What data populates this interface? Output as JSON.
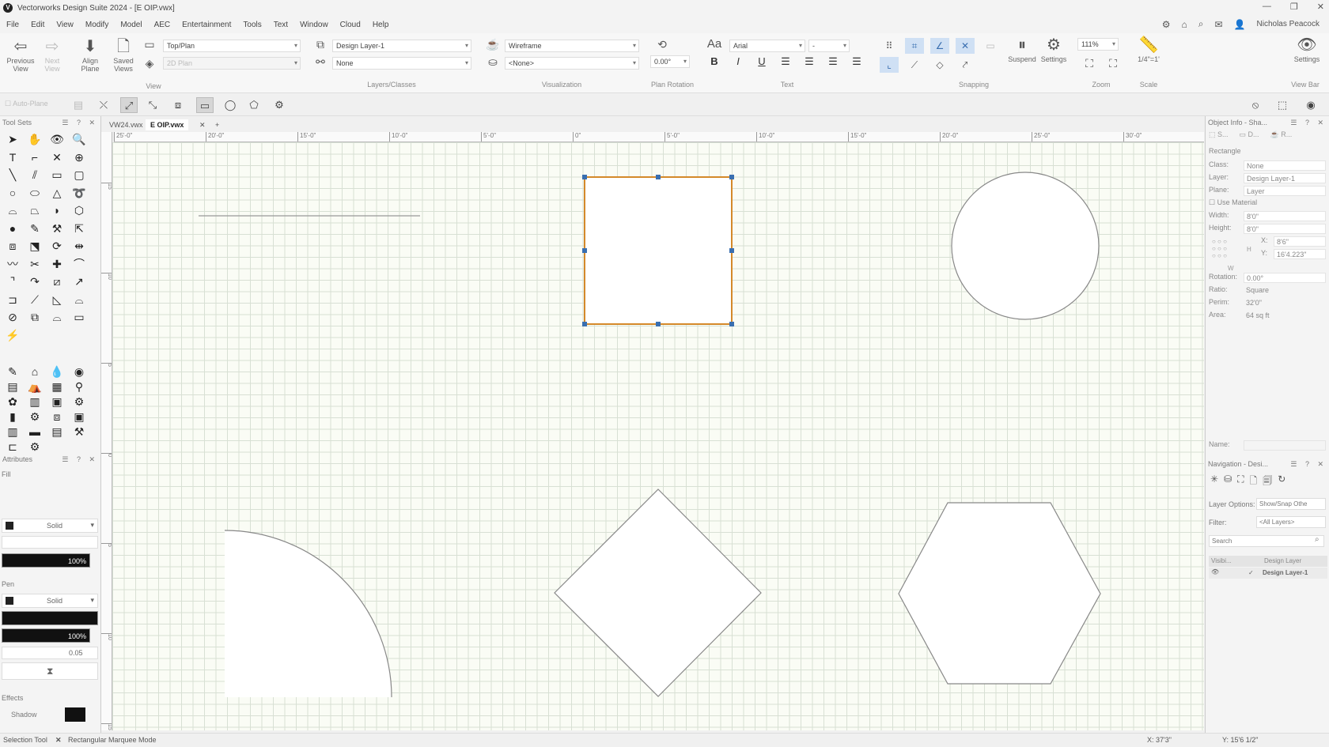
{
  "window": {
    "title": "Vectorworks Design Suite 2024 - [E OIP.vwx]",
    "logo": "V"
  },
  "menu": [
    "File",
    "Edit",
    "View",
    "Modify",
    "Model",
    "AEC",
    "Entertainment",
    "Tools",
    "Text",
    "Window",
    "Cloud",
    "Help"
  ],
  "user": "Nicholas Peacock",
  "ribbon": {
    "previous_view": "Previous View",
    "next_view": "Next View",
    "align_plane": "Align Plane",
    "saved_views": "Saved Views",
    "view_dropdown": "Top/Plan",
    "plane_dropdown": "2D Plan",
    "group_view": "View",
    "layer_dropdown": "Design Layer-1",
    "class_dropdown": "None",
    "group_layers": "Layers/Classes",
    "render_dropdown": "Wireframe",
    "lighting_dropdown": "<None>",
    "group_visualization": "Visualization",
    "plan_rotation_value": "0.00°",
    "group_plan_rotation": "Plan Rotation",
    "font_dropdown": "Arial",
    "size_dropdown": "-",
    "group_text": "Text",
    "suspend": "Suspend",
    "snap_settings": "Settings",
    "group_snapping": "Snapping",
    "zoom_value": "111%",
    "group_zoom": "Zoom",
    "scale_value": "1/4\"=1'",
    "group_scale": "Scale",
    "viewbar_settings": "Settings",
    "group_viewbar": "View Bar"
  },
  "toolbar2": {
    "auto_plane": "Auto-Plane"
  },
  "tool_sets": {
    "title": "Tool Sets"
  },
  "doc_tabs": [
    "VW24.vwx",
    "E OIP.vwx"
  ],
  "ruler_h": [
    "25'-0\"",
    "20'-0\"",
    "15'-0\"",
    "10'-0\"",
    "5'-0\"",
    "0\"",
    "5'-0\"",
    "10'-0\"",
    "15'-0\"",
    "20'-0\"",
    "25'-0\"",
    "30'-0\""
  ],
  "ruler_v": [
    "15",
    "10",
    "5",
    "0",
    "5",
    "10",
    "15"
  ],
  "attributes": {
    "title": "Attributes",
    "fill_label": "Fill",
    "fill_style": "Solid",
    "fill_opacity": "100%",
    "pen_label": "Pen",
    "pen_style": "Solid",
    "pen_opacity": "100%",
    "line_weight": "0.05",
    "effects_label": "Effects",
    "shadow_label": "Shadow"
  },
  "object_info": {
    "title": "Object Info - Sha...",
    "tab_s": "S...",
    "tab_d": "D...",
    "tab_r": "R...",
    "object_type": "Rectangle",
    "rows": [
      {
        "k": "Class:",
        "v": "None"
      },
      {
        "k": "Layer:",
        "v": "Design Layer-1"
      },
      {
        "k": "Plane:",
        "v": "Layer"
      }
    ],
    "use_material": "Use Material",
    "width_label": "Width:",
    "width": "8'0\"",
    "height_label": "Height:",
    "height": "8'0\"",
    "x_label": "X:",
    "x": "8'6\"",
    "y_label": "Y:",
    "y": "16'4.223\"",
    "h_label": "H",
    "w_label": "W",
    "rotation_label": "Rotation:",
    "rotation": "0.00°",
    "ratio_label": "Ratio:",
    "ratio": "Square",
    "perim_label": "Perim:",
    "perim": "32'0\"",
    "area_label": "Area:",
    "area": "64 sq ft",
    "name_label": "Name:"
  },
  "navigation": {
    "title": "Navigation - Desi...",
    "layer_options_label": "Layer Options:",
    "layer_options": "Show/Snap Othe",
    "filter_label": "Filter:",
    "filter": "<All Layers>",
    "search_placeholder": "Search",
    "col_visibility": "Visibi...",
    "col_design_layer": "Design Layer",
    "row_layer": "Design Layer-1",
    "row_check": "✓"
  },
  "status": {
    "tool": "Selection Tool",
    "mode": "Rectangular Marquee Mode",
    "x": "X: 37'3\"",
    "y": "Y: 15'6 1/2\""
  },
  "colors": {
    "selection": "#d4892a",
    "handle": "#3a6fb0",
    "shape_stroke": "#888888"
  }
}
